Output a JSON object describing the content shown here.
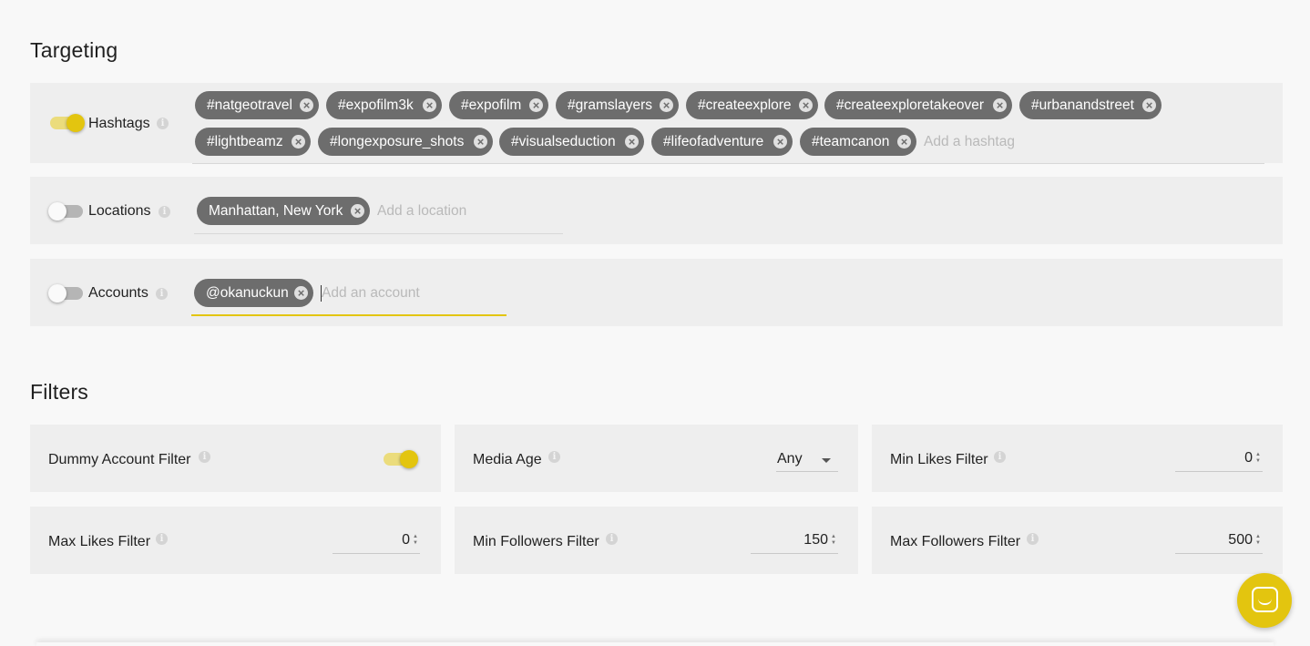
{
  "targeting": {
    "title": "Targeting",
    "hashtags": {
      "label": "Hashtags",
      "enabled": true,
      "tags_row1": [
        "#natgeotravel",
        "#expofilm3k",
        "#expofilm",
        "#gramslayers",
        "#createexplore",
        "#createexploretakeover",
        "#urbanandstreet"
      ],
      "tags_row2": [
        "#lightbeamz",
        "#longexposure_shots",
        "#visualseduction",
        "#lifeofadventure",
        "#teamcanon"
      ],
      "placeholder": "Add a hashtag"
    },
    "locations": {
      "label": "Locations",
      "enabled": false,
      "tags": [
        "Manhattan, New York"
      ],
      "placeholder": "Add a location"
    },
    "accounts": {
      "label": "Accounts",
      "enabled": false,
      "tags": [
        "@okanuckun"
      ],
      "placeholder": "Add an account"
    }
  },
  "filters": {
    "title": "Filters",
    "dummy_account": {
      "label": "Dummy Account Filter",
      "enabled": true
    },
    "media_age": {
      "label": "Media Age",
      "value": "Any"
    },
    "min_likes": {
      "label": "Min Likes Filter",
      "value": "0"
    },
    "max_likes": {
      "label": "Max Likes Filter",
      "value": "0"
    },
    "min_followers": {
      "label": "Min Followers Filter",
      "value": "150"
    },
    "max_followers": {
      "label": "Max Followers Filter",
      "value": "500"
    }
  },
  "icons": {
    "info": "info-icon",
    "chip_remove": "close-circle-icon",
    "chat": "chat-bubble-icon"
  },
  "colors": {
    "accent": "#e3c50f",
    "chip": "#6d6d6d",
    "panel": "#eeeeee",
    "background": "#f8f8f8"
  }
}
